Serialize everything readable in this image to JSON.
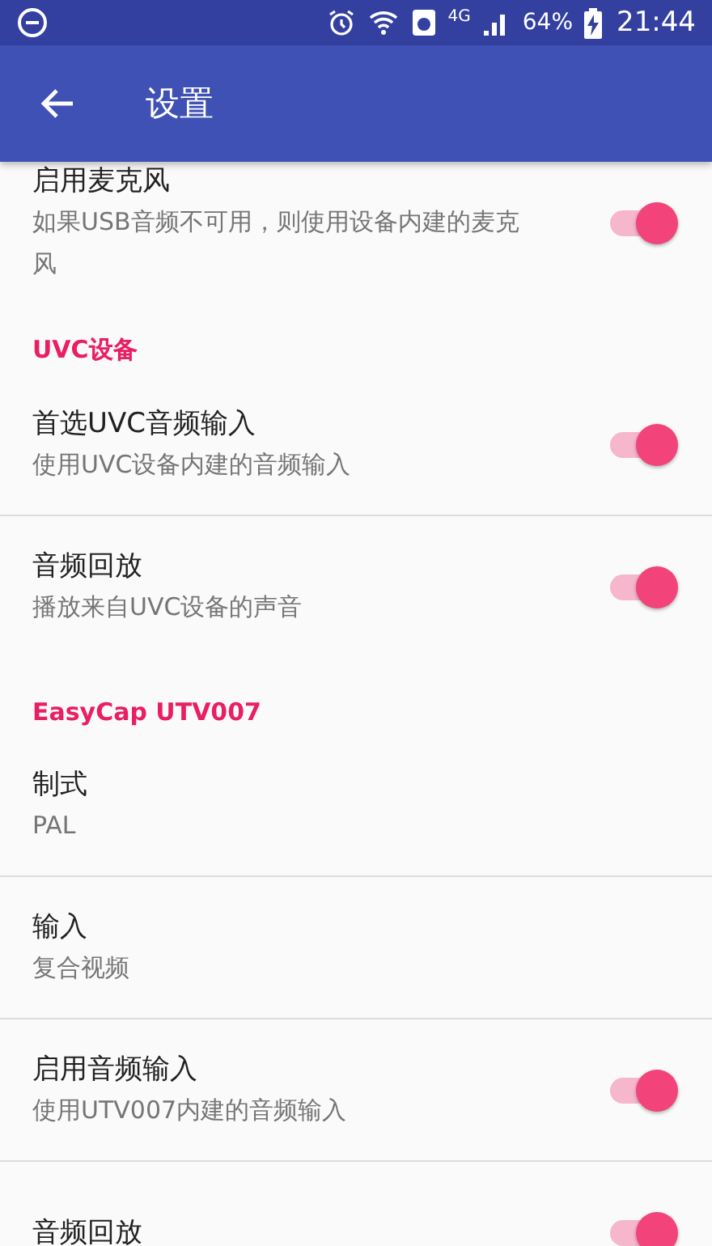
{
  "status_bar": {
    "battery": "64%",
    "time": "21:44",
    "network": "4G"
  },
  "app_bar": {
    "title": "设置"
  },
  "entries": [
    {
      "kind": "item",
      "title": "启用麦克风",
      "summary": "如果USB音频不可用，则使用设备内建的麦克风",
      "on": true,
      "divider": false,
      "clipped": true
    },
    {
      "kind": "category",
      "title": "UVC设备"
    },
    {
      "kind": "item",
      "title": "首选UVC音频输入",
      "summary": "使用UVC设备内建的音频输入",
      "on": true,
      "divider": true
    },
    {
      "kind": "item",
      "title": "音频回放",
      "summary": "播放来自UVC设备的声音",
      "on": true,
      "divider": false
    },
    {
      "kind": "category",
      "title": "EasyCap UTV007"
    },
    {
      "kind": "item",
      "title": "制式",
      "summary": "PAL",
      "divider": true
    },
    {
      "kind": "item",
      "title": "输入",
      "summary": "复合视频",
      "divider": true
    },
    {
      "kind": "item",
      "title": "启用音频输入",
      "summary": "使用UTV007内建的音频输入",
      "on": true,
      "divider": true
    },
    {
      "kind": "item",
      "title": "音频回放",
      "on": true,
      "divider": false
    }
  ]
}
